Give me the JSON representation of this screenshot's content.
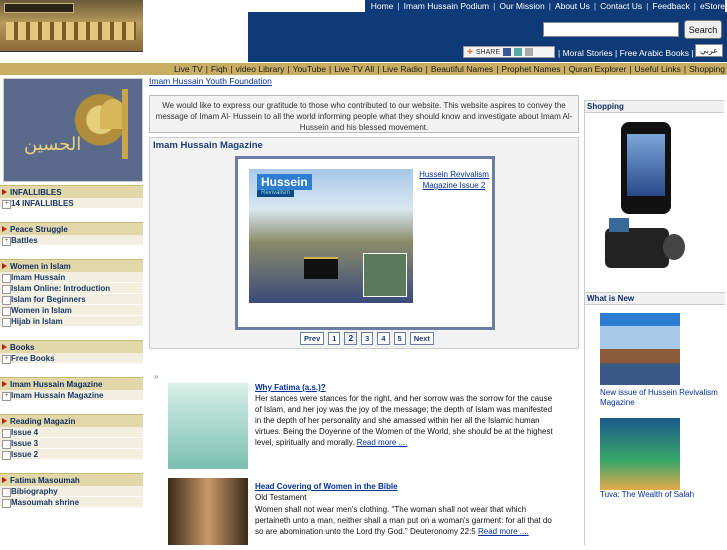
{
  "header": {
    "top_links": [
      "Home",
      "Imam Hussain Podium",
      "Our Mission",
      "About Us",
      "Contact Us",
      "Feedback",
      "eStore"
    ],
    "search_button": "Search",
    "search_placeholder": "",
    "share_label": "SHARE",
    "secondary_links": [
      "Moral Stories",
      "Free Arabic Books"
    ],
    "arabic_label": "عربي"
  },
  "navbar": [
    "Live TV",
    "Fiqh",
    "video Library",
    "YouTube",
    "Live TV All",
    "Live Radio",
    "Beautiful Names",
    "Prophet Names",
    "Quran Explorer",
    "Useful Links",
    "Shopping"
  ],
  "sidebar": {
    "sections": [
      {
        "title": "INFALLIBLES",
        "items": [
          "14 INFALLIBLES"
        ]
      },
      {
        "title": "Peace Struggle",
        "items": [
          "Battles"
        ]
      },
      {
        "title": "Women in Islam",
        "items": [
          "Imam Hussain",
          "Islam Online: Introduction",
          "Islam for Beginners",
          "Women in Islam",
          "Hijab in Islam"
        ]
      },
      {
        "title": "Books",
        "items": [
          "Free Books"
        ]
      },
      {
        "title": "Imam Hussain Magazine",
        "items": [
          "Imam Hussain Magazine"
        ]
      },
      {
        "title": "Reading Magazin",
        "items": [
          "Issue 4",
          "Issue 3",
          "Issue 2"
        ]
      },
      {
        "title": "Fatima Masoumah",
        "items": [
          "Bibiography",
          "Masoumah shrine"
        ]
      }
    ]
  },
  "center": {
    "youth_link": "Imam Hussain Youth Foundation",
    "gratitude": "We would like to express our gratitude to those who contributed to our website. This website aspires to convey the message of Imam Al- Hussein to all the world informing people what they should know and investigate about Imam Al-Hussein and his blessed movement.",
    "magazine": {
      "title": "Imam Hussain Magazine",
      "cover_logo": "Hussein",
      "cover_sub": "Revivalism",
      "link": "Hussein Revivalism Magazine Issue 2",
      "pager": [
        "Prev",
        "1",
        "2",
        "3",
        "4",
        "5",
        "Next"
      ],
      "current_page": "2"
    },
    "articles": [
      {
        "title": "Why Fatima (a.s.)?",
        "body": "Her stances were stances for the right, and her sorrow was the sorrow for the cause of Islam, and her joy was the joy of the message; the depth of Islam was manifested in the depth of her personality and she amassed within her all the Islamic human virtues. Being the Doyenne of the Women of the World, she should be at the highest level, spiritually and morally.",
        "more": "Read more ...."
      },
      {
        "title": "Head Covering of Women in the Bible",
        "sub": "Old Testament",
        "body": "Women shall not wear men's clothing. \"The woman shall not wear that which pertaineth unto a man, neither shall a man put on a woman's garment: for all that do so are abomination unto the Lord thy God.\" Deuteronomy 22:5",
        "more": "Read more ...."
      }
    ]
  },
  "right": {
    "shopping_title": "Shopping",
    "whatsnew_title": "What is New",
    "items": [
      {
        "caption": "New issue of Hussein Revivalism Magazine"
      },
      {
        "caption": "Tuva: The Wealth of Salah"
      }
    ]
  },
  "colors": {
    "header_blue": "#0f3a78",
    "nav_gold": "#c8ad62",
    "link": "#00309a"
  }
}
